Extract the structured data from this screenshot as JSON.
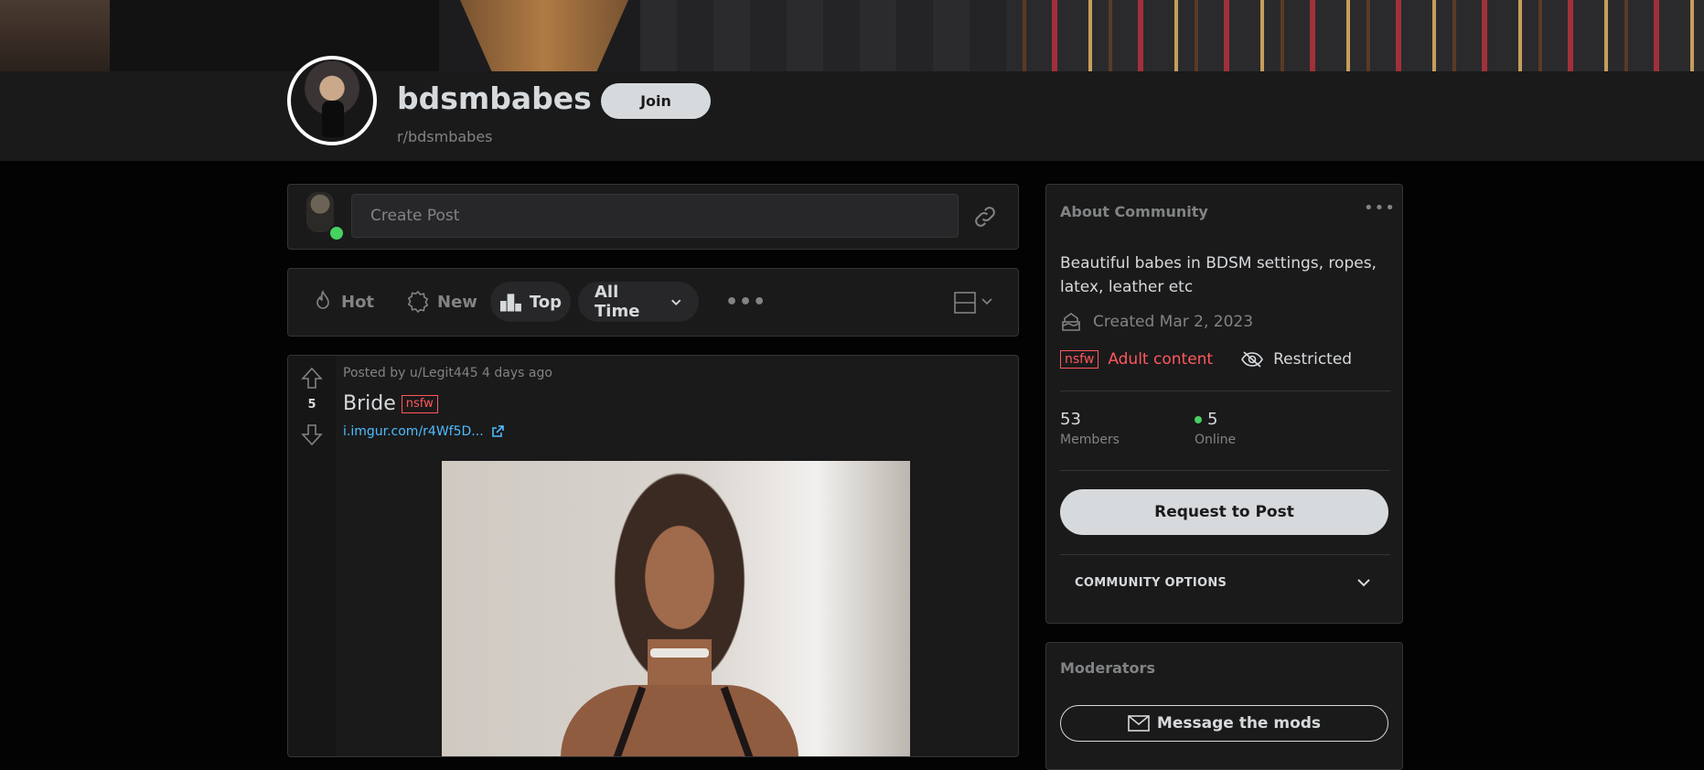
{
  "subreddit": {
    "name": "bdsmbabes",
    "path": "r/bdsmbabes",
    "join_label": "Join"
  },
  "create_post": {
    "placeholder": "Create Post"
  },
  "sort": {
    "hot": "Hot",
    "new": "New",
    "top": "Top",
    "time": "All Time",
    "active": "Top"
  },
  "post": {
    "meta": "Posted by u/Legit445 4 days ago",
    "title": "Bride",
    "tag": "nsfw",
    "link": "i.imgur.com/r4Wf5D...",
    "votes": "5"
  },
  "about": {
    "title": "About Community",
    "description": "Beautiful babes in BDSM settings, ropes, latex, leather etc",
    "created": "Created Mar 2, 2023",
    "nsfw_tag": "nsfw",
    "adult_label": "Adult content",
    "restricted_label": "Restricted",
    "members_count": "53",
    "members_label": "Members",
    "online_count": "5",
    "online_label": "Online",
    "request_button": "Request to Post",
    "options_label": "COMMUNITY OPTIONS"
  },
  "moderators": {
    "title": "Moderators",
    "message_button": "Message the mods"
  },
  "colors": {
    "background": "#030303",
    "card": "#1a1a1b",
    "border": "#343536",
    "text": "#d7dadc",
    "muted": "#818384",
    "nsfw": "#ff585b",
    "link": "#4fbcff",
    "online": "#46d160"
  }
}
